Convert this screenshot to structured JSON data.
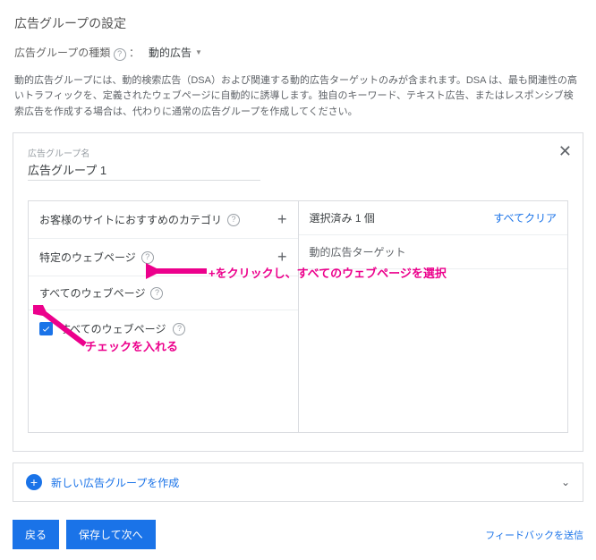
{
  "title": "広告グループの設定",
  "typeRow": {
    "label": "広告グループの種類",
    "colon": "：",
    "value": "動的広告"
  },
  "description": "動的広告グループには、動的検索広告（DSA）および関連する動的広告ターゲットのみが含まれます。DSA は、最も関連性の高いトラフィックを、定義されたウェブページに自動的に誘導します。独自のキーワード、テキスト広告、またはレスポンシブ検索広告を作成する場合は、代わりに通常の広告グループを作成してください。",
  "groupName": {
    "label": "広告グループ名",
    "value": "広告グループ 1"
  },
  "leftRows": [
    {
      "label": "お客様のサイトにおすすめのカテゴリ"
    },
    {
      "label": "特定のウェブページ"
    },
    {
      "label": "すべてのウェブページ"
    }
  ],
  "rightHead": {
    "selected": "選択済み 1 個",
    "clear": "すべてクリア"
  },
  "rightSub": "動的広告ターゲット",
  "allPagesCheckbox": "すべてのウェブページ",
  "annotations": {
    "plus": "+をクリックし、すべてのウェブページを選択",
    "check": "チェックを入れる"
  },
  "newGroup": "新しい広告グループを作成",
  "footer": {
    "back": "戻る",
    "saveNext": "保存して次へ",
    "feedback": "フィードバックを送信"
  }
}
